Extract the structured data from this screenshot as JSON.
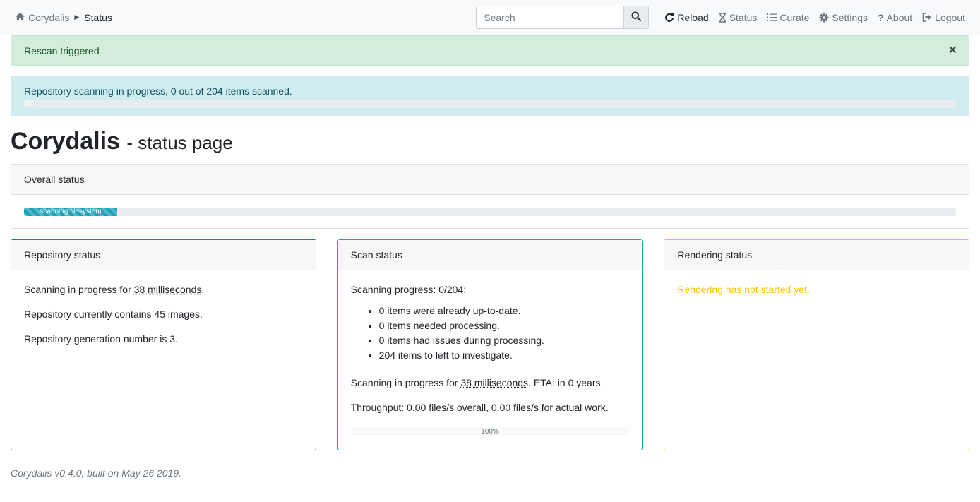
{
  "navbar": {
    "brand": "Corydalis",
    "current": "Status",
    "search_placeholder": "Search",
    "menu": [
      {
        "label": "Reload",
        "icon": "refresh-icon",
        "active": true
      },
      {
        "label": "Status",
        "icon": "hourglass-icon",
        "active": false
      },
      {
        "label": "Curate",
        "icon": "tasks-icon",
        "active": false
      },
      {
        "label": "Settings",
        "icon": "gear-icon",
        "active": false
      },
      {
        "label": "About",
        "icon": "question-icon",
        "active": false
      },
      {
        "label": "Logout",
        "icon": "sign-out-icon",
        "active": false
      }
    ]
  },
  "alerts": {
    "success": "Rescan triggered",
    "close": "×",
    "info": "Repository scanning in progress, 0 out of 204 items scanned.",
    "info_progress_label": "0%",
    "info_progress": 0
  },
  "heading": {
    "title": "Corydalis",
    "subtitle": "- status page"
  },
  "overall": {
    "header": "Overall status",
    "progress_label": "scanning filesystem",
    "progress_fraction": 0.1
  },
  "repository": {
    "header": "Repository status",
    "line1_prefix": "Scanning in progress for",
    "line1_duration": "38 milliseconds",
    "line1_suffix": ".",
    "line2": "Repository currently contains 45 images.",
    "line3": "Repository generation number is 3."
  },
  "scan": {
    "header": "Scan status",
    "progress_text": "Scanning progress: 0/204:",
    "items": [
      "0 items were already up-to-date.",
      "0 items needed processing.",
      "0 items had issues during processing.",
      "204 items to left to investigate."
    ],
    "line_prefix": "Scanning in progress for",
    "line_duration": "38 milliseconds",
    "line_suffix": ". ETA: in 0 years.",
    "throughput": "Throughput: 0.00 files/s overall, 0.00 files/s for actual work.",
    "progress_label": "100%",
    "progress": 100
  },
  "rendering": {
    "header": "Rendering status",
    "text": "Rendering has not started yet."
  },
  "footer": "Corydalis v0.4.0, built on May 26 2019.",
  "colors": {
    "success_bg": "#d4edda",
    "info_bg": "#d1ecf1",
    "primary": "#007bff",
    "info": "#17a2b8",
    "warning": "#ffc107"
  }
}
